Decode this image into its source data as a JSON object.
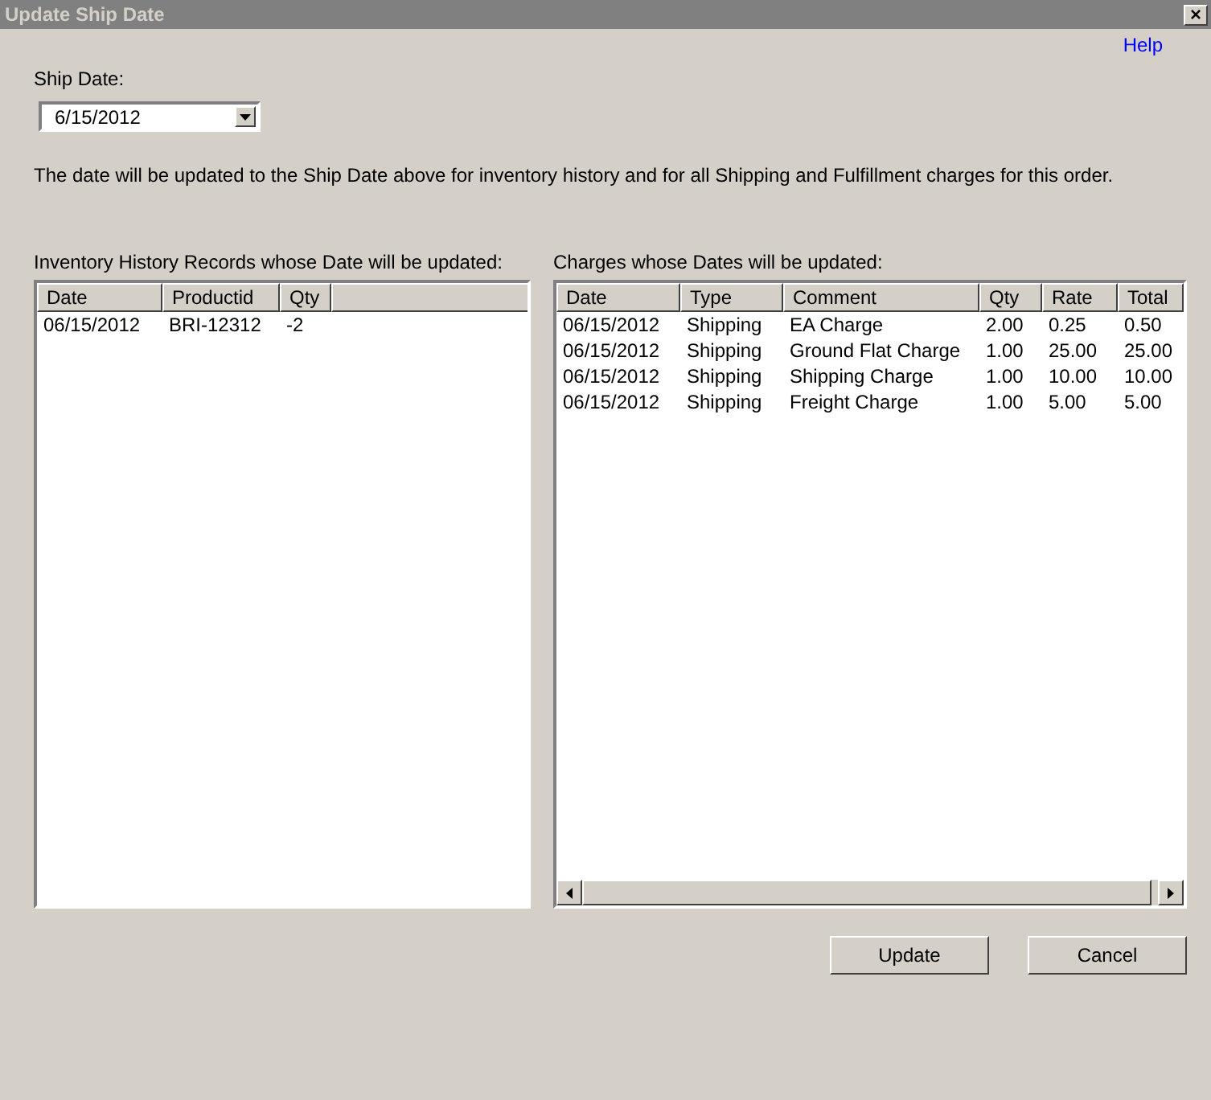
{
  "window": {
    "title": "Update Ship Date",
    "close": "×"
  },
  "help_link": "Help",
  "ship_date": {
    "label": "Ship Date:",
    "value": "6/15/2012"
  },
  "description": "The date will be updated to the Ship Date above for inventory history and for all Shipping and Fulfillment charges for this order.",
  "inventory": {
    "label": "Inventory History Records whose Date will be updated:",
    "columns": [
      "Date",
      "Productid",
      "Qty"
    ],
    "rows": [
      [
        "06/15/2012",
        "BRI-12312",
        "-2"
      ]
    ]
  },
  "charges": {
    "label": "Charges whose Dates will be updated:",
    "columns": [
      "Date",
      "Type",
      "Comment",
      "Qty",
      "Rate",
      "Total"
    ],
    "rows": [
      [
        "06/15/2012",
        "Shipping",
        "EA Charge",
        "2.00",
        "0.25",
        "0.50"
      ],
      [
        "06/15/2012",
        "Shipping",
        "Ground Flat Charge",
        "1.00",
        "25.00",
        "25.00"
      ],
      [
        "06/15/2012",
        "Shipping",
        "Shipping Charge",
        "1.00",
        "10.00",
        "10.00"
      ],
      [
        "06/15/2012",
        "Shipping",
        "Freight Charge",
        "1.00",
        "5.00",
        "5.00"
      ]
    ]
  },
  "buttons": [
    "Update",
    "Cancel"
  ]
}
